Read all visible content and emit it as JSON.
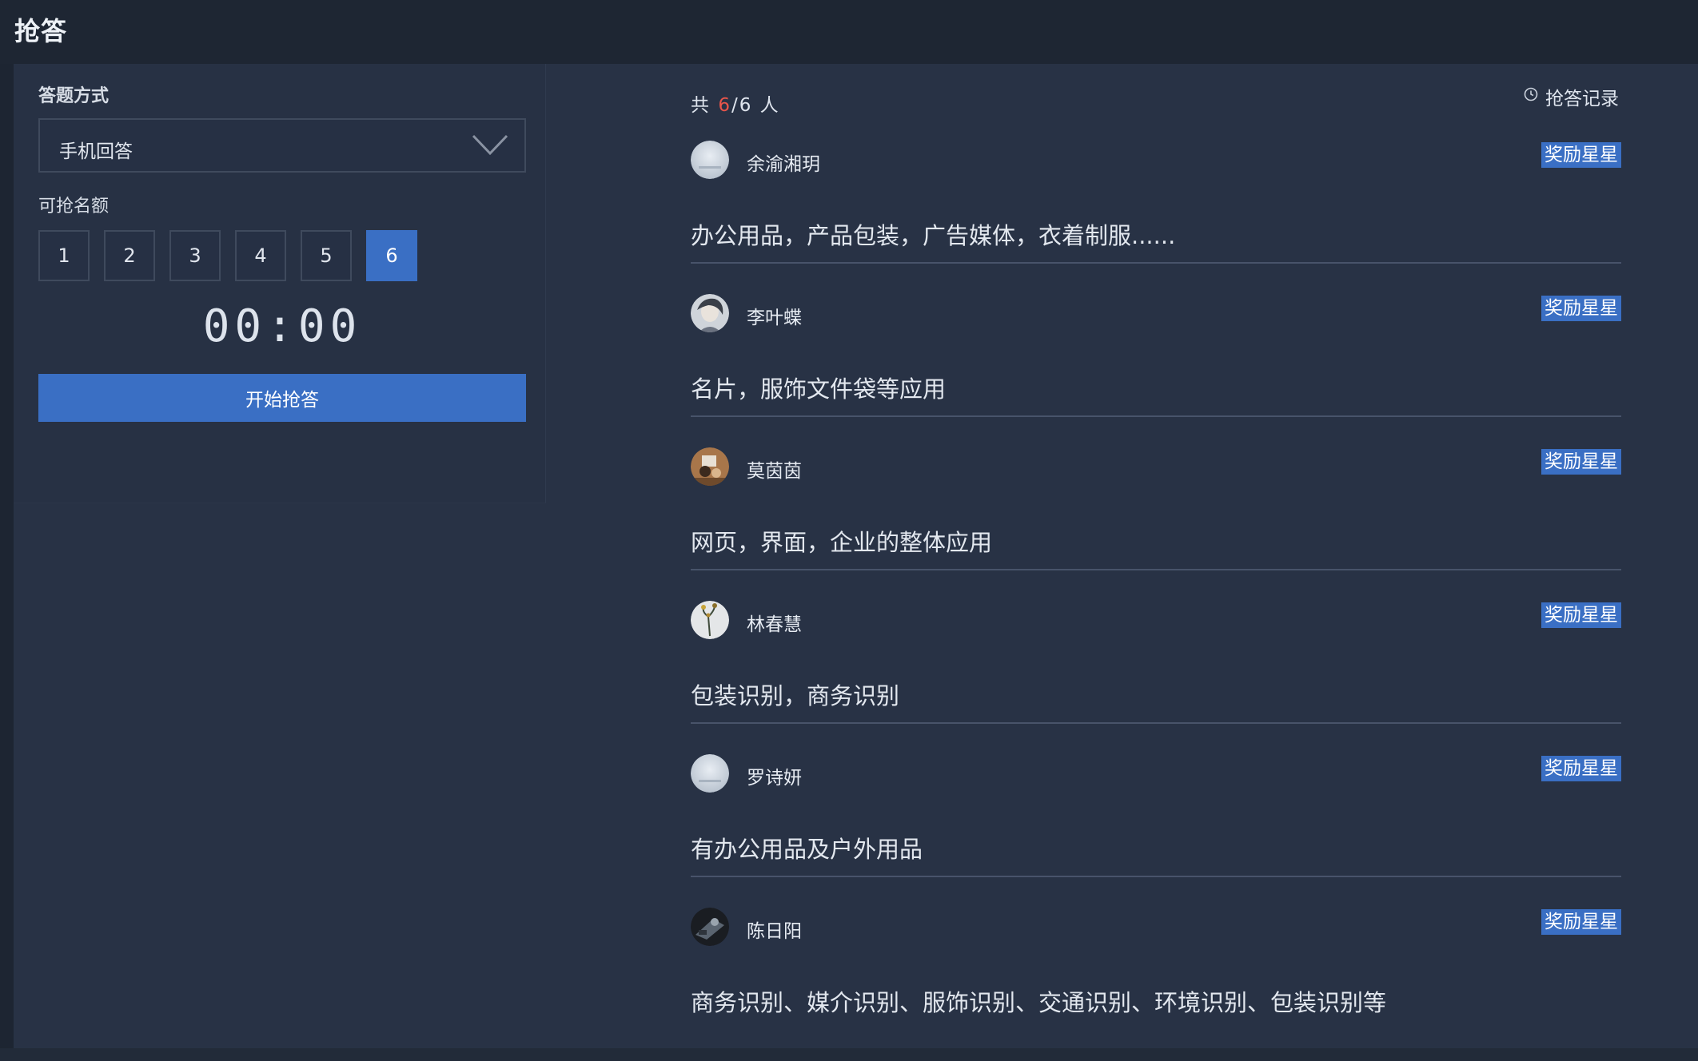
{
  "header": {
    "title": "抢答"
  },
  "controls": {
    "mode_label": "答题方式",
    "mode_value": "手机回答",
    "quota_label": "可抢名额",
    "quota_options": [
      "1",
      "2",
      "3",
      "4",
      "5",
      "6"
    ],
    "quota_selected": "6",
    "timer": "00:00",
    "start_label": "开始抢答"
  },
  "summary": {
    "prefix": "共",
    "answered": "6",
    "separator": "/",
    "total": "6",
    "suffix": "人",
    "records_label": "抢答记录",
    "records_icon": "clock-icon"
  },
  "entries": [
    {
      "name": "余渝湘玥",
      "reward_label": "奖励星星",
      "answer": "办公用品，产品包装，广告媒体，衣着制服......"
    },
    {
      "name": "李叶蝶",
      "reward_label": "奖励星星",
      "answer": "名片，服饰文件袋等应用"
    },
    {
      "name": "莫茵茵",
      "reward_label": "奖励星星",
      "answer": "网页，界面，企业的整体应用"
    },
    {
      "name": "林春慧",
      "reward_label": "奖励星星",
      "answer": "包装识别，商务识别"
    },
    {
      "name": "罗诗妍",
      "reward_label": "奖励星星",
      "answer": "有办公用品及户外用品"
    },
    {
      "name": "陈日阳",
      "reward_label": "奖励星星",
      "answer": "商务识别、媒介识别、服饰识别、交通识别、环境识别、包装识别等"
    }
  ],
  "colors": {
    "accent": "#3a6fc4",
    "highlight_red": "#e8554a",
    "background": "#283245"
  }
}
